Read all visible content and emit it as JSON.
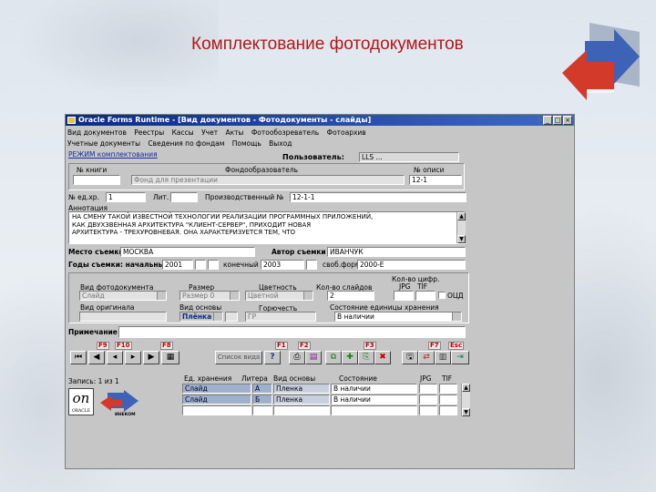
{
  "slide": {
    "title": "Комплектование фотодокументов"
  },
  "window": {
    "title": "Oracle Forms Runtime - [Вид документов - Фотодокументы - слайды]"
  },
  "menu": [
    "Вид документов",
    "Реестры",
    "Кассы",
    "Учет",
    "Акты",
    "Фотообозреватель",
    "Фотоархив"
  ],
  "menu2": [
    "Учетные документы",
    "Сведения по фондам",
    "Помощь",
    "Выход"
  ],
  "mode_link": "РЕЖИМ комплектования",
  "user": {
    "label": "Пользователь:",
    "value": "LLS ..."
  },
  "hdr": {
    "col1": "№ книги",
    "col2": "Фондообразователь",
    "col3": "№ описи"
  },
  "fields": {
    "fond": "Фонд для презентации",
    "opis": "12-1",
    "ned_label": "№ ед.хр.",
    "ned": "1",
    "list_label": "Лит.",
    "list": "",
    "prod_label": "Производственный №",
    "prod": "12-1-1"
  },
  "annot": {
    "label": "Аннотация",
    "text": "НА СМЕНУ ТАКОЙ ИЗВЕСТНОЙ ТЕХНОЛОГИИ РЕАЛИЗАЦИИ ПРОГРАММНЫХ ПРИЛОЖЕНИЙ,\nКАК ДВУХЗВЕННАЯ АРХИТЕКТУРА \"КЛИЕНТ-СЕРВЕР\", ПРИХОДИТ НОВАЯ\nАРХИТЕКТУРА - ТРЕХУРОВНЕВАЯ. ОНА ХАРАКТЕРИЗУЕТСЯ ТЕМ, ЧТО"
  },
  "place": {
    "label": "Место съемки",
    "value": "МОСКВА"
  },
  "author": {
    "label": "Автор съемки",
    "value": "ИВАНЧУК"
  },
  "years": {
    "label": "Годы съемки: начальный",
    "start": "2001",
    "end_label": "конечный",
    "end": "2003",
    "free_label": "своб.форма",
    "free": "2000-Е"
  },
  "photo": {
    "vid_label": "Вид фотодокумента",
    "vid": "Слайд",
    "razm_label": "Размер",
    "razm": "Размер 0",
    "color_label": "Цветность",
    "color": "Цветной",
    "kol_label": "Кол-во слайдов",
    "kol": "2",
    "copies_label": "Кол-во цифр.",
    "jpg": "JPG",
    "tif": "TIF",
    "ocd": "ОЦД",
    "orig_label": "Вид оригинала",
    "orig": "",
    "osnova_label": "Вид основы",
    "osnova": "Плёнка",
    "gor_label": "Горючесть",
    "gor": "ГР",
    "state_label": "Состояние единицы хранения",
    "state": "В наличии"
  },
  "note": {
    "label": "Примечание",
    "value": ""
  },
  "fkeys": [
    "F9",
    "F10",
    "F8",
    "F1",
    "F2",
    "F3",
    "F7",
    "Esc"
  ],
  "toolbar": {
    "list_btn": "Список вида",
    "help_btn": "?"
  },
  "record": "Запись: 1 из 1",
  "grid": {
    "headers": [
      "Ед. хранения",
      "Литера",
      "Вид основы",
      "Состояние",
      "JPG",
      "TIF"
    ],
    "rows": [
      {
        "unit": "Слайд",
        "lit": "А",
        "base": "Пленка",
        "state": "В наличии"
      },
      {
        "unit": "Слайд",
        "lit": "Б",
        "base": "Пленка",
        "state": "В наличии"
      },
      {
        "unit": "",
        "lit": "",
        "base": "",
        "state": ""
      }
    ]
  },
  "logo": {
    "mark": "on",
    "caption": "ORACLE",
    "sub": "ИНЕКОМ"
  }
}
